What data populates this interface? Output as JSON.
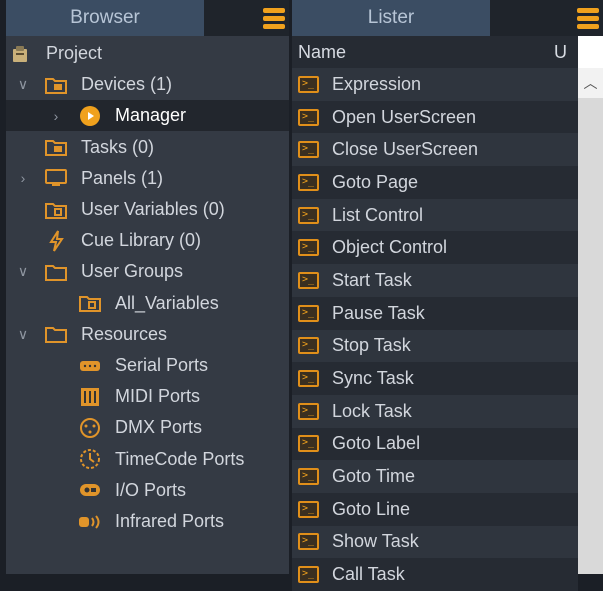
{
  "browser": {
    "title": "Browser",
    "tree": [
      {
        "label": "Project",
        "icon": "project-icon",
        "chevron": ""
      },
      {
        "label": "Devices (1)",
        "icon": "devices-folder-icon",
        "chevron": "expanded"
      },
      {
        "label": "Manager",
        "icon": "manager-play-icon",
        "chevron": "collapsed",
        "selected": true
      },
      {
        "label": "Tasks (0)",
        "icon": "tasks-icon",
        "chevron": ""
      },
      {
        "label": "Panels (1)",
        "icon": "monitor-icon",
        "chevron": "collapsed"
      },
      {
        "label": "User Variables (0)",
        "icon": "variables-icon",
        "chevron": ""
      },
      {
        "label": "Cue Library (0)",
        "icon": "lightning-icon",
        "chevron": ""
      },
      {
        "label": "User Groups",
        "icon": "folder-icon",
        "chevron": "expanded"
      },
      {
        "label": "All_Variables",
        "icon": "variables-icon",
        "chevron": ""
      },
      {
        "label": "Resources",
        "icon": "folder-icon",
        "chevron": "expanded"
      },
      {
        "label": "Serial Ports",
        "icon": "serial-port-icon",
        "chevron": ""
      },
      {
        "label": "MIDI Ports",
        "icon": "midi-port-icon",
        "chevron": ""
      },
      {
        "label": "DMX Ports",
        "icon": "dmx-port-icon",
        "chevron": ""
      },
      {
        "label": "TimeCode Ports",
        "icon": "timecode-icon",
        "chevron": ""
      },
      {
        "label": "I/O Ports",
        "icon": "io-port-icon",
        "chevron": ""
      },
      {
        "label": "Infrared Ports",
        "icon": "infrared-icon",
        "chevron": ""
      }
    ]
  },
  "lister": {
    "title": "Lister",
    "columns": {
      "name": "Name",
      "u": "U"
    },
    "items": [
      "Expression",
      "Open UserScreen",
      "Close UserScreen",
      "Goto Page",
      "List Control",
      "Object Control",
      "Start Task",
      "Pause Task",
      "Stop Task",
      "Sync Task",
      "Lock Task",
      "Goto Label",
      "Goto Time",
      "Goto Line",
      "Show Task",
      "Call Task"
    ]
  },
  "colors": {
    "accent": "#f0a11d",
    "title_bg": "#3b4d63"
  }
}
